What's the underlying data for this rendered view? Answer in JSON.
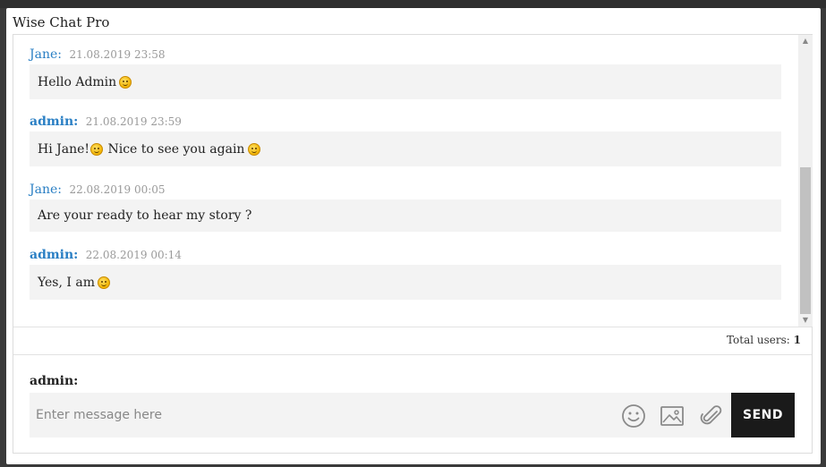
{
  "window": {
    "title": "Wise Chat Pro"
  },
  "messages": [
    {
      "sender": "Jane",
      "time": "21.08.2019 23:58",
      "text": "Hello Admin",
      "emoji_after": true,
      "is_admin": false
    },
    {
      "sender": "admin",
      "time": "21.08.2019 23:59",
      "text_before": "Hi Jane!",
      "text_after": " Nice to see you again",
      "is_admin": true
    },
    {
      "sender": "Jane",
      "time": "22.08.2019 00:05",
      "text": "Are your ready to hear my story ?",
      "is_admin": false
    },
    {
      "sender": "admin",
      "time": "22.08.2019 00:14",
      "text": "Yes, I am",
      "emoji_after": true,
      "is_admin": true
    }
  ],
  "stats": {
    "total_users_label": "Total users:",
    "total_users_value": "1"
  },
  "composer": {
    "current_user": "admin:",
    "placeholder": "Enter message here",
    "send_label": "SEND",
    "icons": [
      "smiley-icon",
      "image-icon",
      "paperclip-icon"
    ]
  },
  "colors": {
    "sender": "#2a7fc4",
    "send_button": "#1a1a1a",
    "bubble": "#f3f3f3"
  }
}
